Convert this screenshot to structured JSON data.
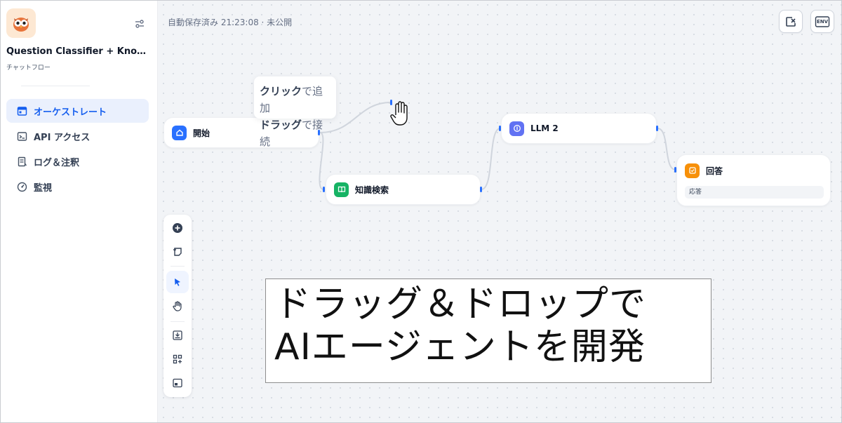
{
  "sidebar": {
    "app_name": "Question Classifier + Knowl...",
    "app_type": "チャットフロー",
    "items": [
      {
        "label": "オーケストレート",
        "icon": "layout-icon"
      },
      {
        "label": "API アクセス",
        "icon": "terminal-icon"
      },
      {
        "label": "ログ＆注釈",
        "icon": "document-icon"
      },
      {
        "label": "監視",
        "icon": "gauge-icon"
      }
    ]
  },
  "header": {
    "autosave_status": "自動保存済み 21:23:08 · 未公開",
    "env_label": "ENV"
  },
  "nodes": {
    "start": {
      "title": "開始",
      "color": "#2970ff"
    },
    "knowledge": {
      "title": "知識検索",
      "color": "#16b364"
    },
    "llm": {
      "title": "LLM 2",
      "color": "#6172f3"
    },
    "answer": {
      "title": "回答",
      "color": "#f79009",
      "field": "応答"
    }
  },
  "tooltip": {
    "click_bold": "クリック",
    "click_rest": "で追加",
    "drag_bold": "ドラッグ",
    "drag_rest": "で接続"
  },
  "caption": {
    "line1": "ドラッグ＆ドロップで",
    "line2": "AIエージェントを開発"
  },
  "colors": {
    "accent": "#155eef",
    "active_bg": "#eaf0fd",
    "edge": "#d0d5dd",
    "handle": "#2970ff"
  }
}
